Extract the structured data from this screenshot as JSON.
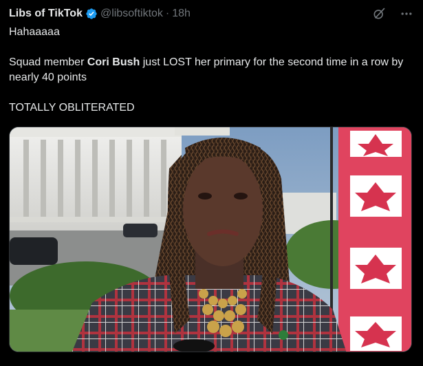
{
  "author": {
    "display_name": "Libs of TikTok",
    "handle": "@libsoftiktok",
    "separator": "·",
    "time": "18h"
  },
  "tweet": {
    "line1": "Hahaaaaa",
    "line2_pre": "Squad member ",
    "line2_bold": "Cori Bush",
    "line2_post": " just LOST her primary for the second time in a row by nearly 40 points",
    "line3": "TOTALLY OBLITERATED"
  },
  "icons": {
    "verified": "verified-badge-icon",
    "grok": "grok-icon",
    "more": "more-icon"
  },
  "colors": {
    "background": "#000000",
    "text": "#e7e9ea",
    "secondary": "#71767b",
    "verified": "#1d9bf0"
  }
}
